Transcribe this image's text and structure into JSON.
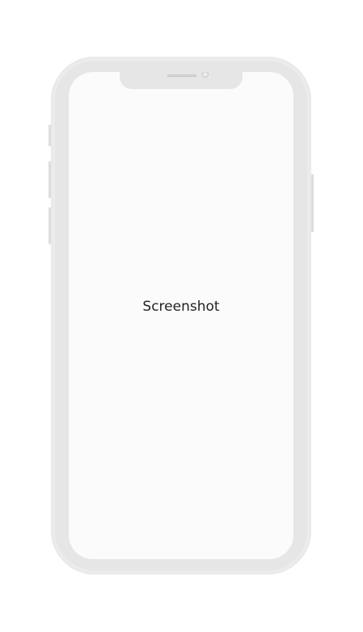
{
  "screen": {
    "label": "Screenshot"
  },
  "icons": {
    "speaker": "speaker-grille-icon",
    "camera": "front-camera-icon"
  },
  "colors": {
    "frame": "#e6e6e6",
    "screen": "#fbfbfb",
    "label": "#222222"
  }
}
